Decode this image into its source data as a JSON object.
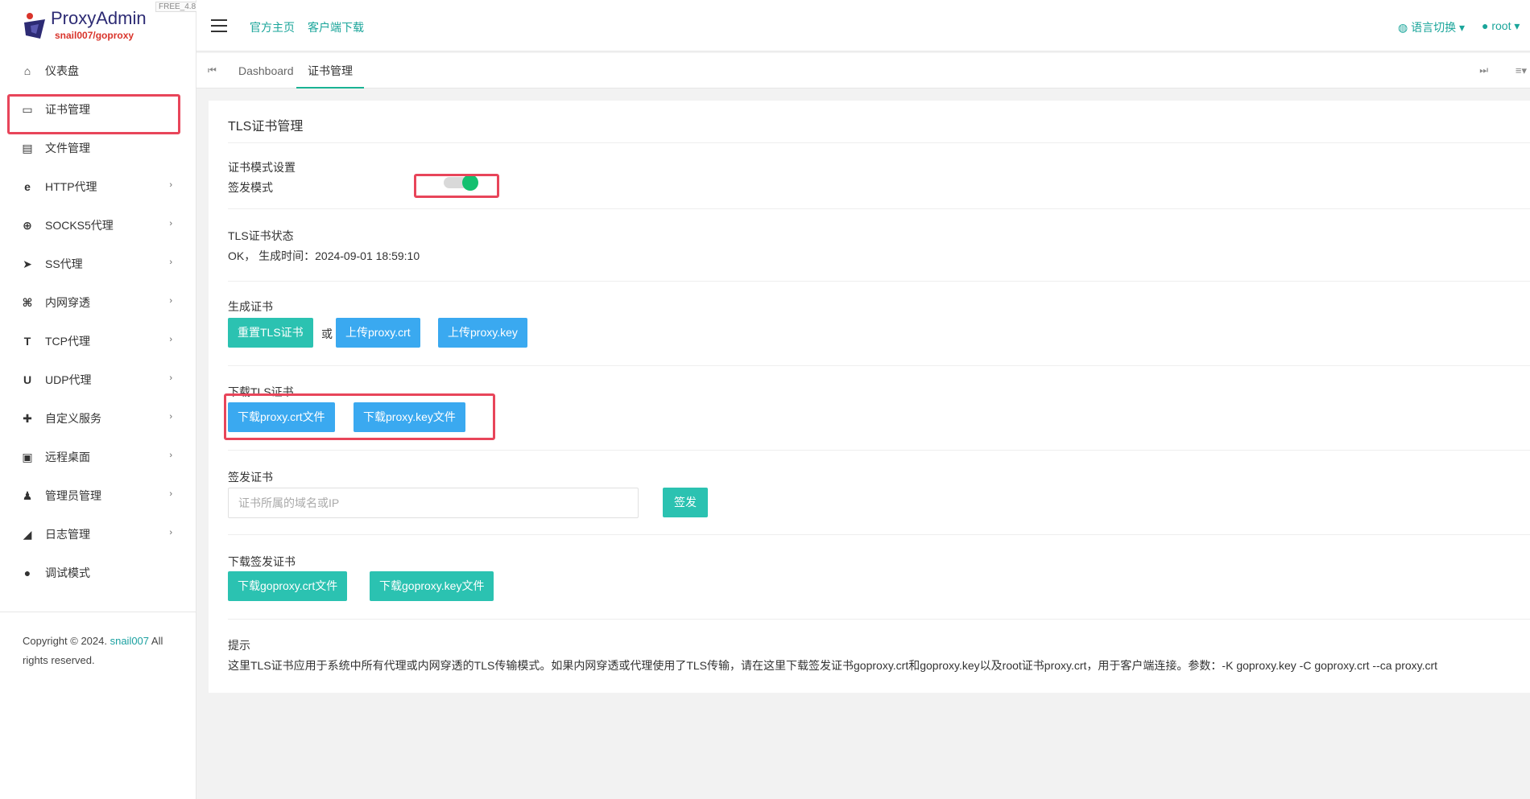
{
  "brand": {
    "title": "ProxyAdmin",
    "subtitle": "snail007/goproxy",
    "version": "FREE_4.8"
  },
  "sidebar": {
    "items": [
      {
        "label": "仪表盘",
        "icon": "home-icon",
        "glyph": "⌂",
        "has_children": false
      },
      {
        "label": "证书管理",
        "icon": "card-icon",
        "glyph": "▭",
        "has_children": false
      },
      {
        "label": "文件管理",
        "icon": "file-icon",
        "glyph": "▤",
        "has_children": false
      },
      {
        "label": "HTTP代理",
        "icon": "ie-icon",
        "glyph": "e",
        "has_children": true
      },
      {
        "label": "SOCKS5代理",
        "icon": "globe-icon",
        "glyph": "⊕",
        "has_children": true
      },
      {
        "label": "SS代理",
        "icon": "paper-plane-icon",
        "glyph": "➤",
        "has_children": true
      },
      {
        "label": "内网穿透",
        "icon": "network-icon",
        "glyph": "⌘",
        "has_children": true
      },
      {
        "label": "TCP代理",
        "icon": "t-icon",
        "glyph": "T",
        "has_children": true
      },
      {
        "label": "UDP代理",
        "icon": "u-icon",
        "glyph": "U",
        "has_children": true
      },
      {
        "label": "自定义服务",
        "icon": "puzzle-icon",
        "glyph": "✚",
        "has_children": true
      },
      {
        "label": "远程桌面",
        "icon": "desktop-icon",
        "glyph": "▣",
        "has_children": true
      },
      {
        "label": "管理员管理",
        "icon": "user-icon",
        "glyph": "♟",
        "has_children": true
      },
      {
        "label": "日志管理",
        "icon": "camera-icon",
        "glyph": "◢",
        "has_children": true
      },
      {
        "label": "调试模式",
        "icon": "bug-icon",
        "glyph": "●",
        "has_children": false
      }
    ],
    "copyright_prefix": "Copyright © 2024. ",
    "copyright_link": "snail007",
    "copyright_suffix": " All rights reserved."
  },
  "header": {
    "links": [
      "官方主页",
      "客户端下载"
    ],
    "language": "语言切换",
    "user": "root"
  },
  "tabs": [
    "Dashboard",
    "证书管理"
  ],
  "page": {
    "title": "TLS证书管理",
    "mode_section": "证书模式设置",
    "mode_label": "签发模式",
    "mode_enabled": true,
    "status_section": "TLS证书状态",
    "status_value": "OK， 生成时间：2024-09-01 18:59:10",
    "generate_section": "生成证书",
    "btn_reset": "重置TLS证书",
    "or_text": "或",
    "btn_upload_crt": "上传proxy.crt",
    "btn_upload_key": "上传proxy.key",
    "download_section": "下载TLS证书",
    "btn_dl_crt": "下载proxy.crt文件",
    "btn_dl_key": "下载proxy.key文件",
    "issue_section": "签发证书",
    "issue_placeholder": "证书所属的域名或IP",
    "btn_issue": "签发",
    "dl_issued_section": "下载签发证书",
    "btn_dl_go_crt": "下载goproxy.crt文件",
    "btn_dl_go_key": "下载goproxy.key文件",
    "tip_section": "提示",
    "tip_text": "这里TLS证书应用于系统中所有代理或内网穿透的TLS传输模式。如果内网穿透或代理使用了TLS传输，请在这里下载签发证书goproxy.crt和goproxy.key以及root证书proxy.crt，用于客户端连接。参数：-K goproxy.key -C goproxy.crt --ca proxy.crt"
  },
  "colors": {
    "accent": "#1ab394",
    "teal_button": "#2bc2b1",
    "blue_button": "#3aa9f0",
    "highlight": "#e8455a",
    "toggle_on": "#13c06f"
  }
}
